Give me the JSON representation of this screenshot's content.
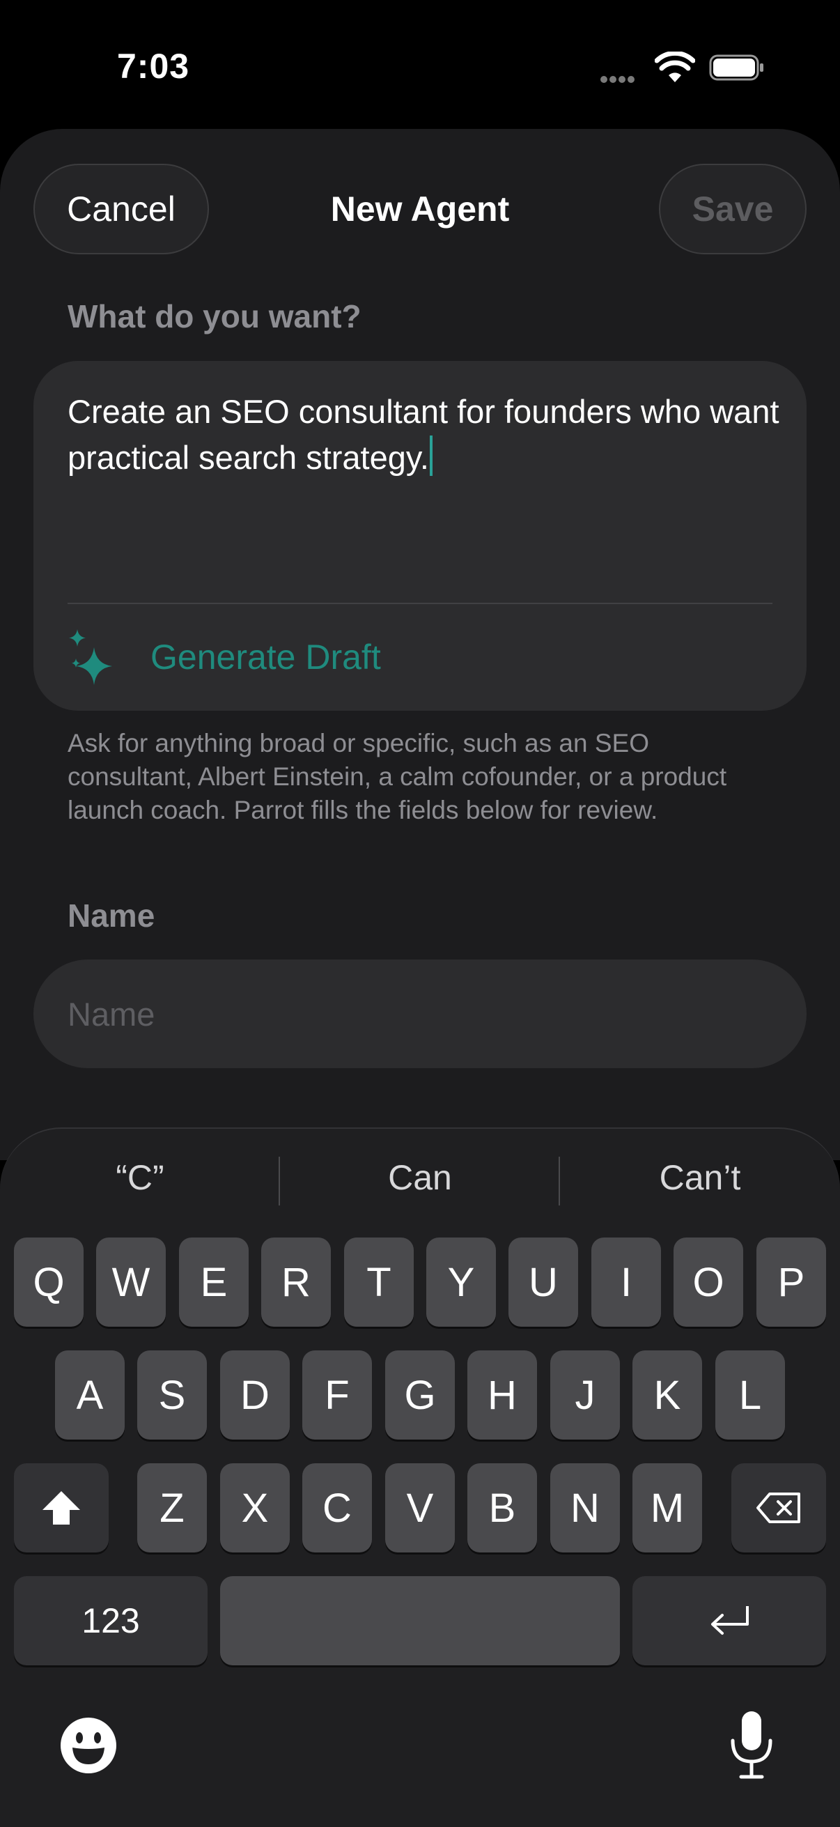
{
  "status_bar": {
    "time": "7:03",
    "icons": [
      "signal-dots-icon",
      "wifi-icon",
      "battery-icon"
    ]
  },
  "header": {
    "cancel_label": "Cancel",
    "title": "New Agent",
    "save_label": "Save"
  },
  "prompt_section": {
    "label": "What do you want?",
    "value": "Create an SEO consultant for founders who want practical search strategy.",
    "generate_label": "Generate Draft",
    "generate_icon": "sparkle-icon",
    "hint": "Ask for anything broad or specific, such as an SEO consultant, Albert Einstein, a calm cofounder, or a product launch coach. Parrot fills the fields below for review."
  },
  "name_section": {
    "label": "Name",
    "placeholder": "Name",
    "value": ""
  },
  "keyboard": {
    "suggestions": [
      "“C”",
      "Can",
      "Can’t"
    ],
    "row1": [
      "Q",
      "W",
      "E",
      "R",
      "T",
      "Y",
      "U",
      "I",
      "O",
      "P"
    ],
    "row2": [
      "A",
      "S",
      "D",
      "F",
      "G",
      "H",
      "J",
      "K",
      "L"
    ],
    "row3": [
      "Z",
      "X",
      "C",
      "V",
      "B",
      "N",
      "M"
    ],
    "numbers_label": "123",
    "icons": [
      "shift-icon",
      "delete-icon",
      "return-icon",
      "emoji-icon",
      "microphone-icon"
    ]
  },
  "colors": {
    "accent": "#1f8b7e",
    "sheet_background": "#1c1c1e",
    "card_background": "#2c2c2e",
    "secondary_text": "#8e8e93"
  }
}
